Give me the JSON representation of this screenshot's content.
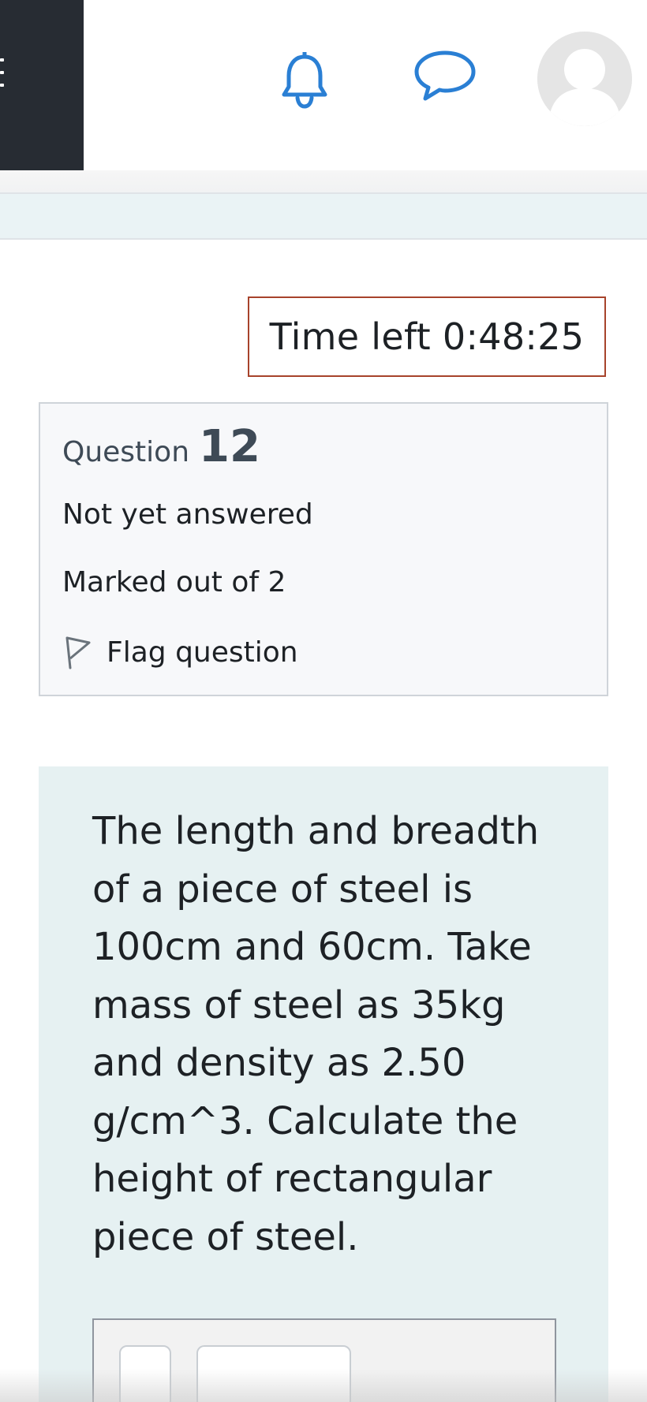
{
  "navbar": {
    "menu_icon": "hamburger-icon",
    "notifications_icon": "bell-icon",
    "messages_icon": "chat-bubble-icon",
    "avatar_icon": "user-avatar-icon",
    "accent_color": "#2a7fd4",
    "drawer_color": "#272c33"
  },
  "timer": {
    "label": "Time left 0:48:25",
    "border_color": "#a7432b"
  },
  "question_info": {
    "label": "Question",
    "number": "12",
    "state": "Not yet answered",
    "grade": "Marked out of 2",
    "flag_label": "Flag question",
    "flag_icon": "flag-outline-icon"
  },
  "question": {
    "text": "The length and breadth of a piece of steel is 100cm and 60cm. Take mass of steel as 35kg and density as 2.50 g/cm^3. Calculate the height of rectangular piece of steel.",
    "background_color": "#e6f1f2"
  }
}
